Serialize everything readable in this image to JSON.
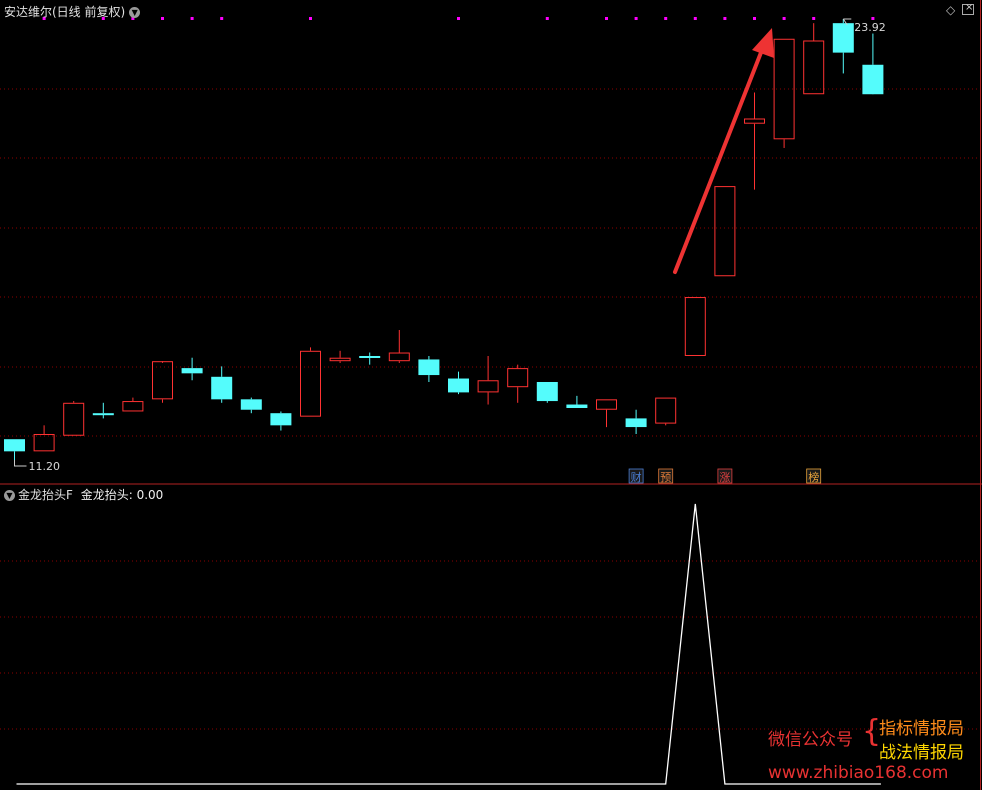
{
  "main_panel": {
    "title": "安达维尔(日线 前复权)",
    "high_label": "23.92",
    "low_label": "11.20",
    "event_badges": [
      {
        "text": "财",
        "color": "#4a7fd6",
        "bar": 21
      },
      {
        "text": "预",
        "color": "#e07b39",
        "bar": 22
      },
      {
        "text": "涨",
        "color": "#e04040",
        "bar": 24
      },
      {
        "text": "榜",
        "color": "#e8a33a",
        "bar": 27
      }
    ]
  },
  "sub_panel": {
    "title": "金龙抬头F",
    "value_label": "金龙抬头: 0.00"
  },
  "watermark": {
    "left": "微信公众号",
    "brace": "{",
    "line1": "指标情报局",
    "line2": "战法情报局",
    "url": "www.zhibiao168.com"
  },
  "colors": {
    "up": "#ff3232",
    "down": "#54fcfc",
    "grid": "#8b0000",
    "marker": "#ff00ff",
    "indicator": "#ffffff",
    "arrow": "#ee3333"
  },
  "chart_data": [
    {
      "type": "candlestick",
      "title": "安达维尔(日线 前复权)",
      "ylim": [
        10.8,
        24.8
      ],
      "ohlc": [
        {
          "o": 11.8,
          "h": 11.8,
          "l": 11.2,
          "c": 11.45
        },
        {
          "o": 11.45,
          "h": 12.2,
          "l": 11.45,
          "c": 11.95
        },
        {
          "o": 11.9,
          "h": 12.9,
          "l": 11.9,
          "c": 12.85
        },
        {
          "o": 12.55,
          "h": 12.85,
          "l": 12.4,
          "c": 12.5
        },
        {
          "o": 12.6,
          "h": 13.0,
          "l": 12.6,
          "c": 12.9
        },
        {
          "o": 12.95,
          "h": 14.0,
          "l": 12.85,
          "c": 14.05
        },
        {
          "o": 13.85,
          "h": 14.15,
          "l": 13.5,
          "c": 13.7
        },
        {
          "o": 13.6,
          "h": 13.9,
          "l": 12.85,
          "c": 12.95
        },
        {
          "o": 12.95,
          "h": 13.0,
          "l": 12.55,
          "c": 12.65
        },
        {
          "o": 12.55,
          "h": 12.6,
          "l": 12.05,
          "c": 12.2
        },
        {
          "o": 12.45,
          "h": 14.45,
          "l": 12.45,
          "c": 14.35
        },
        {
          "o": 14.05,
          "h": 14.35,
          "l": 14.0,
          "c": 14.15
        },
        {
          "o": 14.2,
          "h": 14.3,
          "l": 13.95,
          "c": 14.15
        },
        {
          "o": 14.05,
          "h": 14.95,
          "l": 14.0,
          "c": 14.3
        },
        {
          "o": 14.1,
          "h": 14.2,
          "l": 13.45,
          "c": 13.65
        },
        {
          "o": 13.55,
          "h": 13.75,
          "l": 13.1,
          "c": 13.15
        },
        {
          "o": 13.15,
          "h": 14.2,
          "l": 12.8,
          "c": 13.5
        },
        {
          "o": 13.3,
          "h": 13.95,
          "l": 12.85,
          "c": 13.85
        },
        {
          "o": 13.45,
          "h": 13.45,
          "l": 12.85,
          "c": 12.9
        },
        {
          "o": 12.8,
          "h": 13.05,
          "l": 12.7,
          "c": 12.7
        },
        {
          "o": 12.65,
          "h": 12.95,
          "l": 12.15,
          "c": 12.95
        },
        {
          "o": 12.4,
          "h": 12.65,
          "l": 11.95,
          "c": 12.15
        },
        {
          "o": 12.25,
          "h": 13.0,
          "l": 12.2,
          "c": 13.0
        },
        {
          "o": 14.2,
          "h": 15.9,
          "l": 14.2,
          "c": 15.9
        },
        {
          "o": 16.5,
          "h": 19.1,
          "l": 16.5,
          "c": 19.1
        },
        {
          "o": 20.9,
          "h": 21.8,
          "l": 19.0,
          "c": 21.05
        },
        {
          "o": 20.45,
          "h": 23.35,
          "l": 20.2,
          "c": 23.35
        },
        {
          "o": 21.75,
          "h": 23.8,
          "l": 21.75,
          "c": 23.3
        },
        {
          "o": 23.8,
          "h": 23.92,
          "l": 22.35,
          "c": 22.95
        },
        {
          "o": 22.6,
          "h": 23.5,
          "l": 21.9,
          "c": 21.75
        }
      ],
      "top_marker_bars": [
        1,
        3,
        4,
        5,
        6,
        7,
        10,
        15,
        18,
        20,
        21,
        22,
        23,
        24,
        25,
        26,
        27,
        29
      ]
    },
    {
      "type": "line",
      "title": "金龙抬头F",
      "series": [
        {
          "name": "金龙抬头",
          "values": [
            0,
            0,
            0,
            0,
            0,
            0,
            0,
            0,
            0,
            0,
            0,
            0,
            0,
            0,
            0,
            0,
            0,
            0,
            0,
            0,
            0,
            0,
            0,
            1,
            0,
            0,
            0,
            0,
            0,
            0
          ]
        }
      ],
      "ylim": [
        0,
        1
      ]
    }
  ]
}
